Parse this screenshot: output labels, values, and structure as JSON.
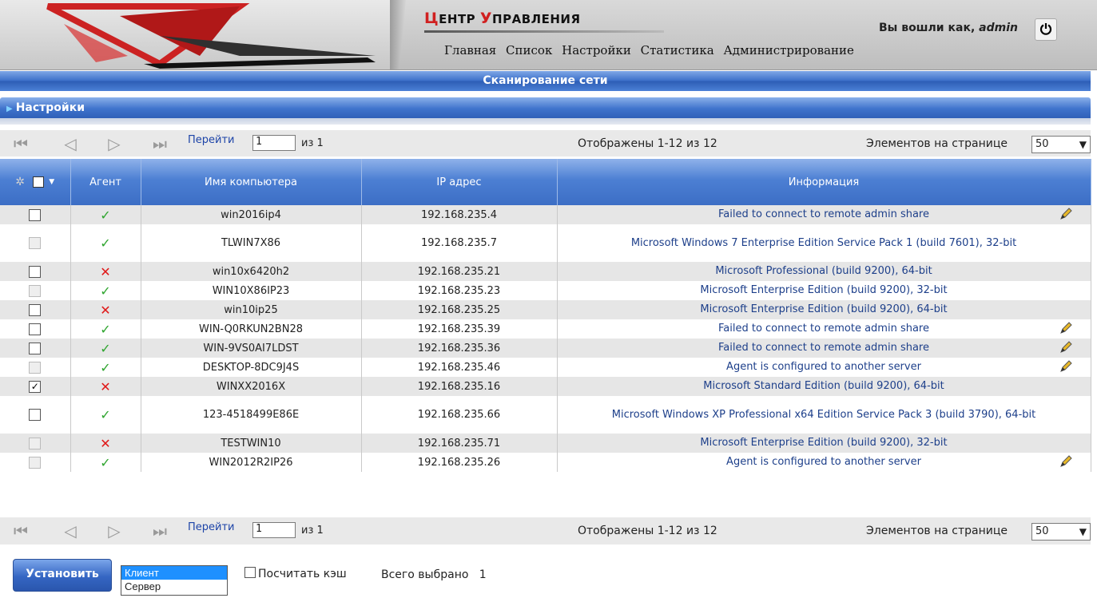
{
  "header": {
    "title_parts": [
      {
        "cap": "Ц",
        "rest": "ЕНТР "
      },
      {
        "cap": "У",
        "rest": "ПРАВЛЕНИЯ"
      }
    ],
    "login_prefix": "Вы вошли как,",
    "login_user": "admin",
    "nav": [
      "Главная",
      "Список",
      "Настройки",
      "Статистика",
      "Администрирование"
    ]
  },
  "scan_bar": "Сканирование сети",
  "settings_bar": "Настройки",
  "pager": {
    "go_label": "Перейти",
    "page_value": "1",
    "of_label": "из 1",
    "shown_label": "Отображены 1-12 из 12",
    "per_page_label": "Элементов на странице",
    "per_page_value": "50"
  },
  "table": {
    "columns": [
      "Агент",
      "Имя компьютера",
      "IP адрес",
      "Информация"
    ],
    "rows": [
      {
        "checked": false,
        "disabled": false,
        "agent": "ok",
        "name": "win2016ip4",
        "ip": "192.168.235.4",
        "info": "Failed to connect to remote admin share",
        "edit": true
      },
      {
        "checked": false,
        "disabled": true,
        "agent": "ok",
        "name": "TLWIN7X86",
        "ip": "192.168.235.7",
        "info": "Microsoft Windows 7 Enterprise Edition Service Pack 1 (build 7601), 32-bit",
        "edit": false
      },
      {
        "checked": false,
        "disabled": false,
        "agent": "bad",
        "name": "win10x6420h2",
        "ip": "192.168.235.21",
        "info": "Microsoft Professional (build 9200), 64-bit",
        "edit": false
      },
      {
        "checked": false,
        "disabled": true,
        "agent": "ok",
        "name": "WIN10X86IP23",
        "ip": "192.168.235.23",
        "info": "Microsoft Enterprise Edition (build 9200), 32-bit",
        "edit": false
      },
      {
        "checked": false,
        "disabled": false,
        "agent": "bad",
        "name": "win10ip25",
        "ip": "192.168.235.25",
        "info": "Microsoft Enterprise Edition (build 9200), 64-bit",
        "edit": false
      },
      {
        "checked": false,
        "disabled": false,
        "agent": "ok",
        "name": "WIN-Q0RKUN2BN28",
        "ip": "192.168.235.39",
        "info": "Failed to connect to remote admin share",
        "edit": true
      },
      {
        "checked": false,
        "disabled": false,
        "agent": "ok",
        "name": "WIN-9VS0AI7LDST",
        "ip": "192.168.235.36",
        "info": "Failed to connect to remote admin share",
        "edit": true
      },
      {
        "checked": false,
        "disabled": true,
        "agent": "ok",
        "name": "DESKTOP-8DC9J4S",
        "ip": "192.168.235.46",
        "info": "Agent is configured to another server",
        "edit": true
      },
      {
        "checked": true,
        "disabled": false,
        "agent": "bad",
        "name": "WINXX2016X",
        "ip": "192.168.235.16",
        "info": "Microsoft Standard Edition (build 9200), 64-bit",
        "edit": false
      },
      {
        "checked": false,
        "disabled": false,
        "agent": "ok",
        "name": "123-4518499E86E",
        "ip": "192.168.235.66",
        "info": "Microsoft Windows XP Professional x64 Edition Service Pack 3 (build 3790), 64-bit",
        "edit": false
      },
      {
        "checked": false,
        "disabled": true,
        "agent": "bad",
        "name": "TESTWIN10",
        "ip": "192.168.235.71",
        "info": "Microsoft Enterprise Edition (build 9200), 32-bit",
        "edit": false
      },
      {
        "checked": false,
        "disabled": true,
        "agent": "ok",
        "name": "WIN2012R2IP26",
        "ip": "192.168.235.26",
        "info": "Agent is configured to another server",
        "edit": true
      }
    ]
  },
  "footer": {
    "install_label": "Установить",
    "roles": [
      "Клиент",
      "Сервер"
    ],
    "selected_role": "Клиент",
    "cache_label": "Посчитать кэш",
    "total_label": "Всего выбрано",
    "total_value": "1"
  },
  "colors": {
    "accent": "#3c6ec5",
    "ok": "#2fa52f",
    "bad": "#e01818",
    "link": "#1d44a8"
  },
  "icons": [
    "power-icon",
    "first-page-icon",
    "prev-page-icon",
    "next-page-icon",
    "last-page-icon",
    "gear-icon",
    "check-icon",
    "cross-icon",
    "edit-pencil-icon",
    "chevron-down-icon"
  ]
}
